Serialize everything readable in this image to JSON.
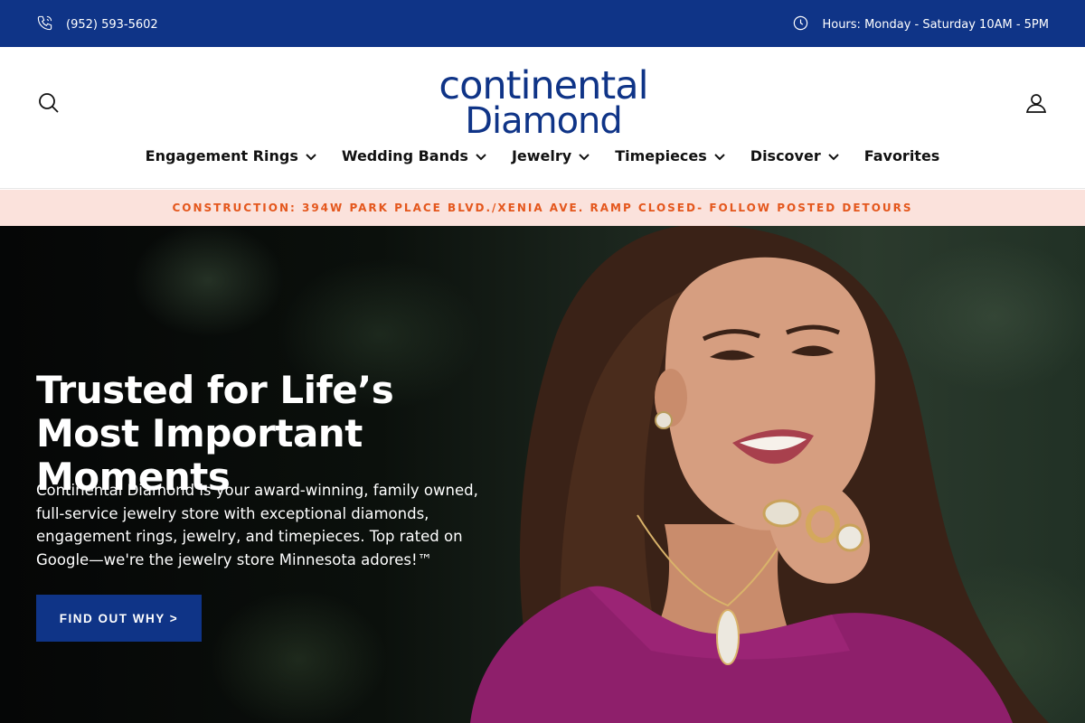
{
  "topbar": {
    "phone": "(952) 593-5602",
    "hours": "Hours: Monday - Saturday 10AM - 5PM",
    "background": "#0f3487"
  },
  "header": {
    "logo_line1": "continental",
    "logo_line2": "Diamond",
    "search_icon": "search-icon",
    "account_icon": "user-icon"
  },
  "nav": {
    "items": [
      {
        "label": "Engagement Rings",
        "has_dropdown": true
      },
      {
        "label": "Wedding Bands",
        "has_dropdown": true
      },
      {
        "label": "Jewelry",
        "has_dropdown": true
      },
      {
        "label": "Timepieces",
        "has_dropdown": true
      },
      {
        "label": "Discover",
        "has_dropdown": true
      },
      {
        "label": "Favorites",
        "has_dropdown": false
      }
    ]
  },
  "notice": {
    "text": "CONSTRUCTION: 394W PARK PLACE BLVD./XENIA AVE. RAMP CLOSED- FOLLOW POSTED DETOURS",
    "background": "#fbe2dc",
    "color": "#e4571d"
  },
  "hero": {
    "title": "Trusted for Life’s Most Important Moments",
    "body": "Continental Diamond is your award-winning, family owned, full-service jewelry store with exceptional diamonds, engagement rings, jewelry, and timepieces. Top rated on Google—we're the jewelry store Minnesota adores!™",
    "cta_label": "FIND OUT WHY >",
    "accent": "#0f3487"
  }
}
